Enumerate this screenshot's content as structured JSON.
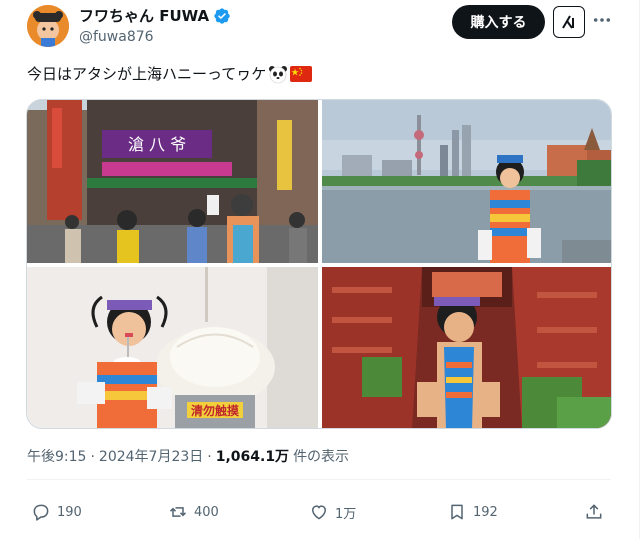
{
  "author": {
    "display_name": "フワちゃん FUWA",
    "handle": "@fuwa876",
    "verified": true
  },
  "header": {
    "buy_label": "購入する",
    "grok_icon": "grok-icon",
    "more_icon": "more-icon"
  },
  "tweet": {
    "text": "今日はアタシが上海ハニーってヮケ",
    "emojis": [
      "panda-emoji",
      "china-flag-emoji"
    ]
  },
  "media": {
    "photos": [
      {
        "alt": "photo-shanghai-street"
      },
      {
        "alt": "photo-bund-skyline"
      },
      {
        "alt": "photo-giant-bun"
      },
      {
        "alt": "photo-red-building"
      }
    ],
    "sign_text_1": "滄 八 爷",
    "sign_text_2": "清勿触摸"
  },
  "meta": {
    "time": "午後9:15",
    "sep1": "·",
    "date": "2024年7月23日",
    "sep2": "·",
    "views": "1,064.1万",
    "views_suffix": "件の表示"
  },
  "actions": {
    "reply_count": "190",
    "retweet_count": "400",
    "like_count": "1万",
    "bookmark_count": "192"
  },
  "colors": {
    "text": "#0f1419",
    "secondary": "#536471",
    "verified": "#1d9bf0",
    "border": "#cfd9de"
  }
}
